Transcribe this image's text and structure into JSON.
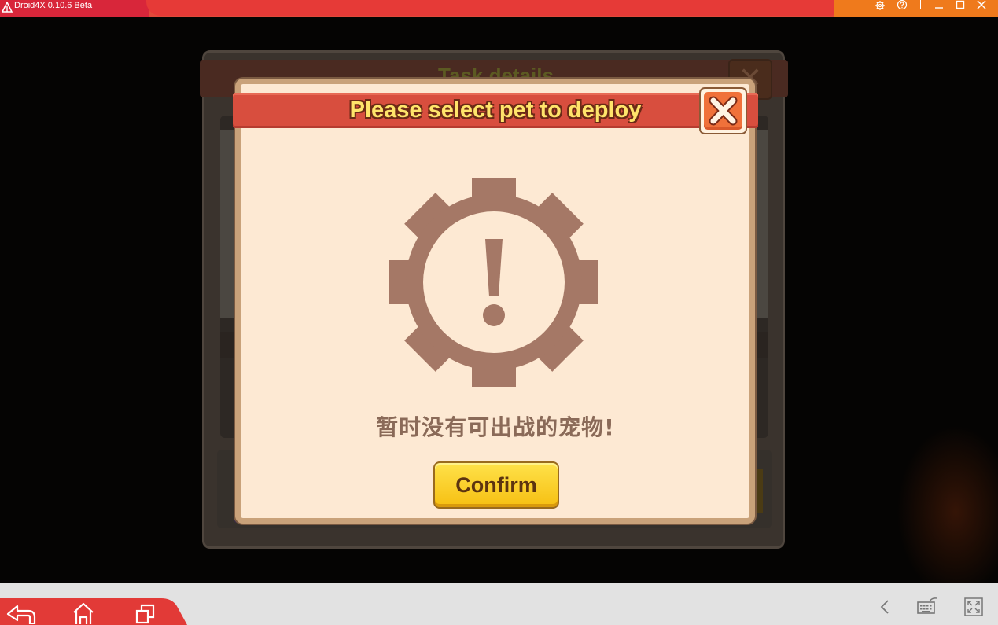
{
  "window": {
    "title": "Droid4X 0.10.6 Beta",
    "colors": {
      "left": "#d8263a",
      "middle": "#e63a37",
      "right": "#ef7a1c"
    },
    "controls": [
      "settings-icon",
      "help-icon",
      "minimize-icon",
      "maximize-icon",
      "close-icon"
    ]
  },
  "background_dialog": {
    "title": "Task details"
  },
  "popup": {
    "title": "Please select pet to deploy",
    "message": "暂时没有可出战的宠物!",
    "confirm_label": "Confirm",
    "icon": "gear-warning-icon",
    "colors": {
      "header": "#d84e3e",
      "title": "#ffe46a",
      "body": "#fde9d3",
      "icon": "#a57866",
      "button": "#f6bf12"
    }
  },
  "navbar": {
    "left_buttons": [
      "back-icon",
      "home-icon",
      "recent-apps-icon"
    ],
    "right_buttons": [
      "chevron-left-icon",
      "keyboard-icon",
      "fullscreen-icon"
    ]
  }
}
